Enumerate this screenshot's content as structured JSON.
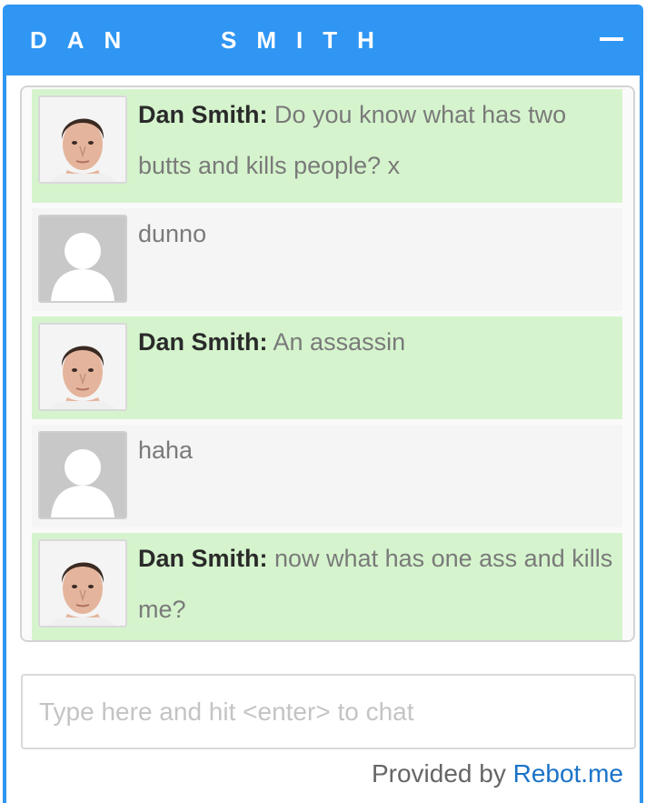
{
  "header": {
    "title": "DAN   SMITH",
    "minimize_icon": "minimize-icon"
  },
  "messages": [
    {
      "role": "bot",
      "sender": "Dan Smith:",
      "text": " Do you know what has two butts and kills people? x",
      "avatar": "bot-face-avatar"
    },
    {
      "role": "user",
      "sender": "",
      "text": "dunno",
      "avatar": "default-user-avatar"
    },
    {
      "role": "bot",
      "sender": "Dan Smith:",
      "text": " An assassin",
      "avatar": "bot-face-avatar"
    },
    {
      "role": "user",
      "sender": "",
      "text": "haha",
      "avatar": "default-user-avatar"
    },
    {
      "role": "bot",
      "sender": "Dan Smith:",
      "text": " now what has one ass and kills me?",
      "avatar": "bot-face-avatar"
    }
  ],
  "input": {
    "placeholder": "Type here and hit <enter> to chat",
    "value": ""
  },
  "footer": {
    "prefix": "Provided by ",
    "link": "Rebot.me"
  },
  "colors": {
    "header": "#2f96f3",
    "bot_bubble": "#d5f4cd",
    "user_bubble": "#f5f5f5",
    "link": "#1a73c8"
  }
}
